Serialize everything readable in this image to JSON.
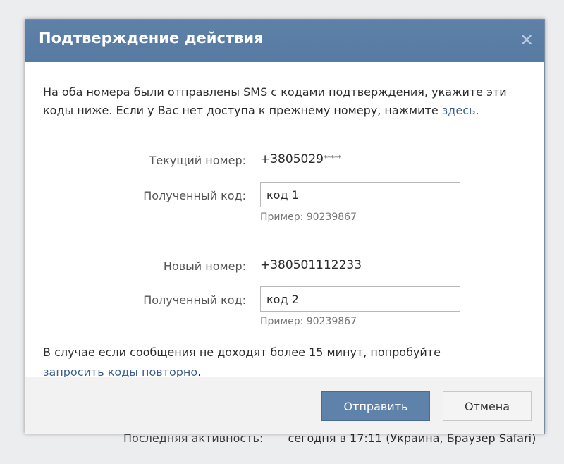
{
  "background": {
    "activity_label": "Последняя активность:",
    "activity_value": "сегодня в 17:11 (Украина, Браузер Safari)"
  },
  "dialog": {
    "title": "Подтверждение действия",
    "close_glyph": "✕",
    "intro_text": "На оба номера были отправлены SMS с кодами подтверждения, укажите эти коды ниже. Если у Вас нет доступа к прежнему номеру, нажмите ",
    "intro_link": "здесь",
    "intro_end": ".",
    "current_number_label": "Текущий номер:",
    "current_number_value": "+3805029",
    "current_number_mask": "*****",
    "code1_label": "Полученный код:",
    "code1_value": "код 1",
    "code1_hint": "Пример: 90239867",
    "new_number_label": "Новый номер:",
    "new_number_value": "+380501112233",
    "code2_label": "Полученный код:",
    "code2_value": "код 2",
    "code2_hint": "Пример: 90239867",
    "note_text": "В случае если сообщения не доходят более 15 минут, попробуйте",
    "note_link": "запросить коды повторно",
    "note_end": ".",
    "submit_label": "Отправить",
    "cancel_label": "Отмена"
  },
  "colors": {
    "header": "#5b7ea6",
    "link": "#3b5f8c",
    "primary_button": "#5e82aa"
  }
}
